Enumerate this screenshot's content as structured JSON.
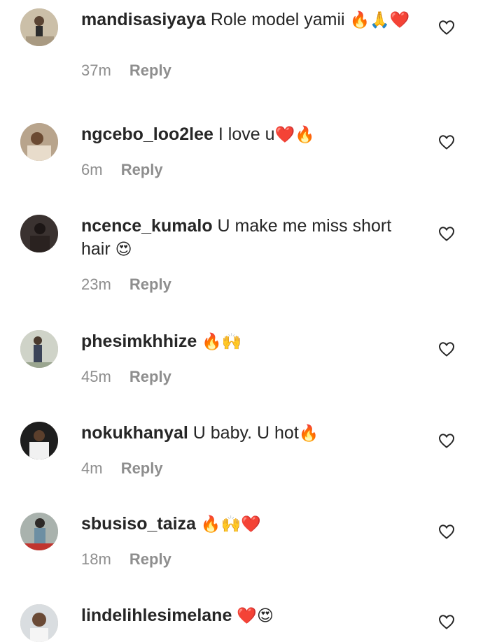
{
  "comments": [
    {
      "username": "mandisasiyaya",
      "text": "Role model yamii",
      "emoji": "🔥🙏❤️",
      "time": "37m",
      "reply": "Reply"
    },
    {
      "username": "ngcebo_loo2lee",
      "text": "I love u",
      "emoji": "❤️🔥",
      "time": "6m",
      "reply": "Reply"
    },
    {
      "username": "ncence_kumalo",
      "text": "U make me miss short hair",
      "emoji": "😍",
      "time": "23m",
      "reply": "Reply"
    },
    {
      "username": "phesimkhhize",
      "text": "",
      "emoji": "🔥🙌",
      "time": "45m",
      "reply": "Reply"
    },
    {
      "username": "nokukhanyal",
      "text": "U baby. U hot",
      "emoji": "🔥",
      "time": "4m",
      "reply": "Reply"
    },
    {
      "username": "sbusiso_taiza",
      "text": "",
      "emoji": "🔥🙌❤️",
      "time": "18m",
      "reply": "Reply"
    },
    {
      "username": "lindelihlesimelane",
      "text": "",
      "emoji": "❤️😍",
      "time": "",
      "reply": ""
    }
  ],
  "icons": {
    "like": "heart-outline-icon",
    "avatar": "user-avatar"
  },
  "colors": {
    "text": "#262626",
    "meta": "#8e8e8e",
    "background": "#ffffff"
  }
}
